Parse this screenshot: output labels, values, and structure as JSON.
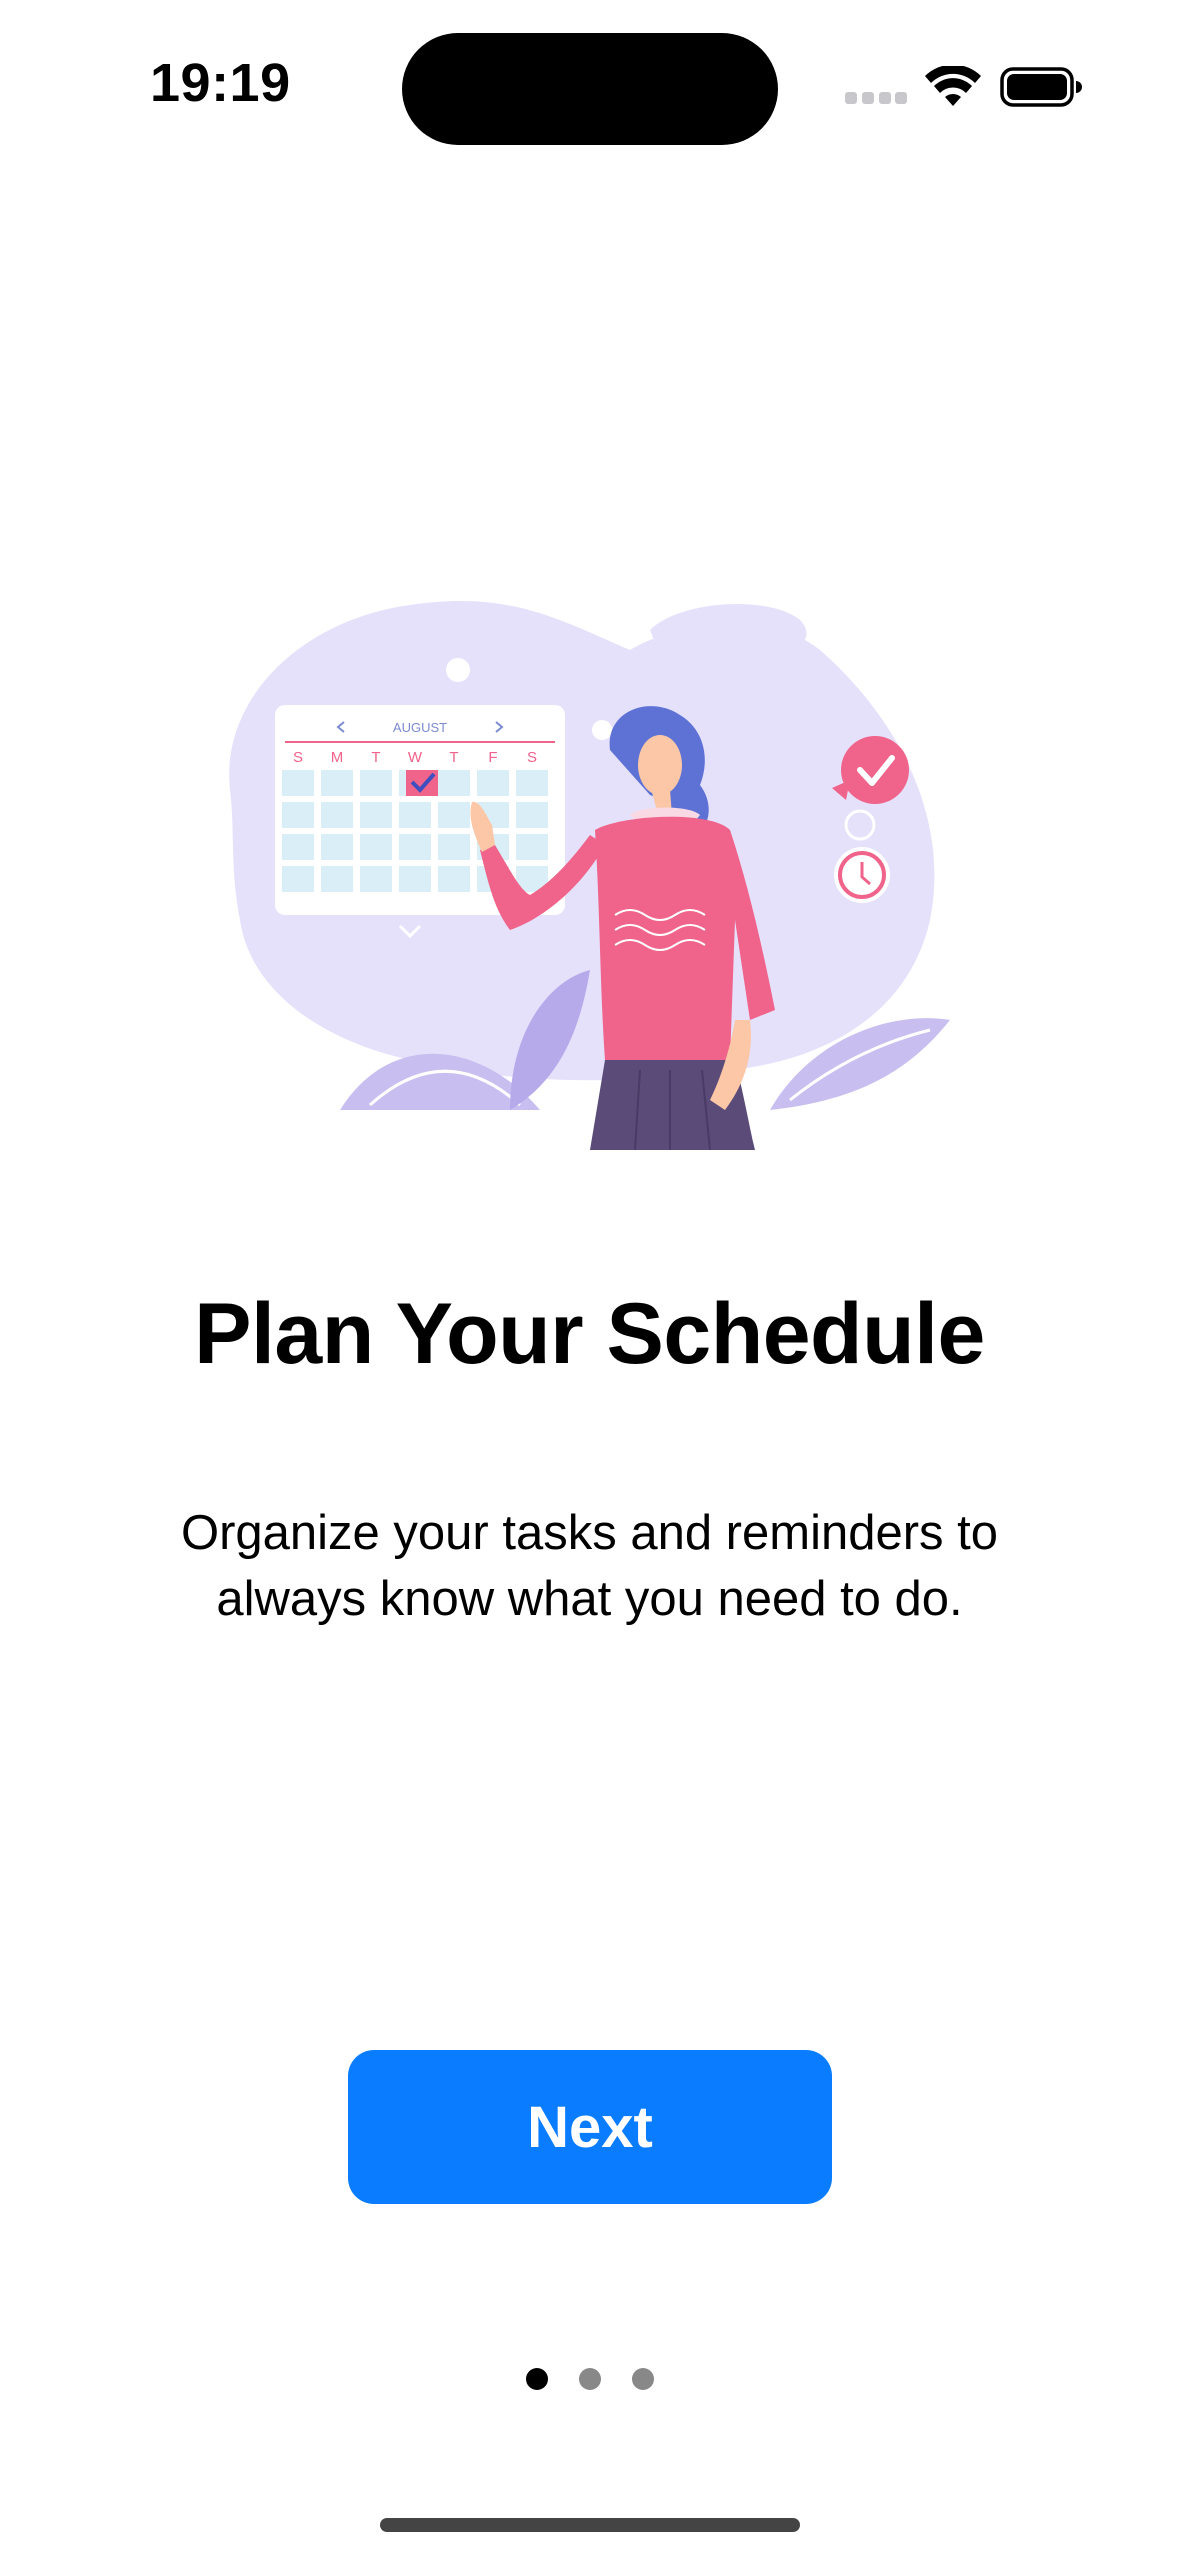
{
  "status_bar": {
    "time": "19:19"
  },
  "onboarding": {
    "calendar_month": "AUGUST",
    "calendar_weekdays": [
      "S",
      "M",
      "T",
      "W",
      "T",
      "F",
      "S"
    ],
    "title": "Plan Your Schedule",
    "subtitle": "Organize your tasks and reminders to always know what you need to do.",
    "next_label": "Next",
    "pages_total": 3,
    "current_page": 1
  },
  "colors": {
    "accent": "#0a7cff",
    "illustration_pink": "#f0638a",
    "illustration_purple": "#e6e1fb"
  }
}
